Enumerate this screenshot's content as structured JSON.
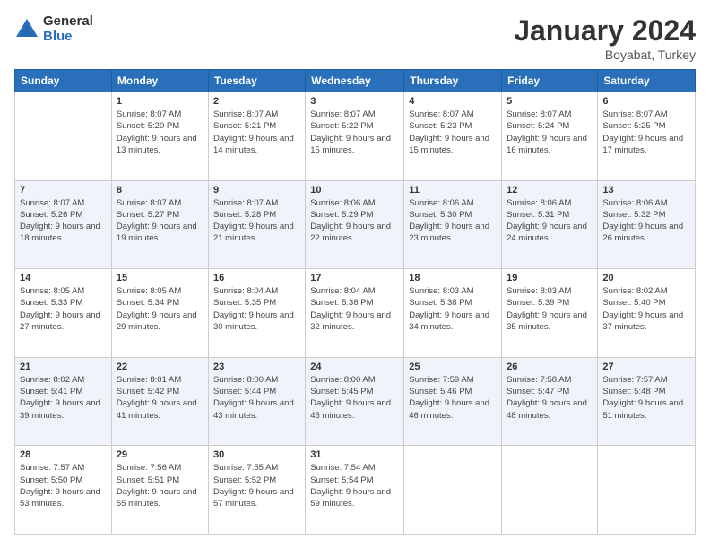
{
  "logo": {
    "general": "General",
    "blue": "Blue"
  },
  "header": {
    "title": "January 2024",
    "subtitle": "Boyabat, Turkey"
  },
  "days_of_week": [
    "Sunday",
    "Monday",
    "Tuesday",
    "Wednesday",
    "Thursday",
    "Friday",
    "Saturday"
  ],
  "weeks": [
    [
      {
        "day": "",
        "sunrise": "",
        "sunset": "",
        "daylight": ""
      },
      {
        "day": "1",
        "sunrise": "Sunrise: 8:07 AM",
        "sunset": "Sunset: 5:20 PM",
        "daylight": "Daylight: 9 hours and 13 minutes."
      },
      {
        "day": "2",
        "sunrise": "Sunrise: 8:07 AM",
        "sunset": "Sunset: 5:21 PM",
        "daylight": "Daylight: 9 hours and 14 minutes."
      },
      {
        "day": "3",
        "sunrise": "Sunrise: 8:07 AM",
        "sunset": "Sunset: 5:22 PM",
        "daylight": "Daylight: 9 hours and 15 minutes."
      },
      {
        "day": "4",
        "sunrise": "Sunrise: 8:07 AM",
        "sunset": "Sunset: 5:23 PM",
        "daylight": "Daylight: 9 hours and 15 minutes."
      },
      {
        "day": "5",
        "sunrise": "Sunrise: 8:07 AM",
        "sunset": "Sunset: 5:24 PM",
        "daylight": "Daylight: 9 hours and 16 minutes."
      },
      {
        "day": "6",
        "sunrise": "Sunrise: 8:07 AM",
        "sunset": "Sunset: 5:25 PM",
        "daylight": "Daylight: 9 hours and 17 minutes."
      }
    ],
    [
      {
        "day": "7",
        "sunrise": "Sunrise: 8:07 AM",
        "sunset": "Sunset: 5:26 PM",
        "daylight": "Daylight: 9 hours and 18 minutes."
      },
      {
        "day": "8",
        "sunrise": "Sunrise: 8:07 AM",
        "sunset": "Sunset: 5:27 PM",
        "daylight": "Daylight: 9 hours and 19 minutes."
      },
      {
        "day": "9",
        "sunrise": "Sunrise: 8:07 AM",
        "sunset": "Sunset: 5:28 PM",
        "daylight": "Daylight: 9 hours and 21 minutes."
      },
      {
        "day": "10",
        "sunrise": "Sunrise: 8:06 AM",
        "sunset": "Sunset: 5:29 PM",
        "daylight": "Daylight: 9 hours and 22 minutes."
      },
      {
        "day": "11",
        "sunrise": "Sunrise: 8:06 AM",
        "sunset": "Sunset: 5:30 PM",
        "daylight": "Daylight: 9 hours and 23 minutes."
      },
      {
        "day": "12",
        "sunrise": "Sunrise: 8:06 AM",
        "sunset": "Sunset: 5:31 PM",
        "daylight": "Daylight: 9 hours and 24 minutes."
      },
      {
        "day": "13",
        "sunrise": "Sunrise: 8:06 AM",
        "sunset": "Sunset: 5:32 PM",
        "daylight": "Daylight: 9 hours and 26 minutes."
      }
    ],
    [
      {
        "day": "14",
        "sunrise": "Sunrise: 8:05 AM",
        "sunset": "Sunset: 5:33 PM",
        "daylight": "Daylight: 9 hours and 27 minutes."
      },
      {
        "day": "15",
        "sunrise": "Sunrise: 8:05 AM",
        "sunset": "Sunset: 5:34 PM",
        "daylight": "Daylight: 9 hours and 29 minutes."
      },
      {
        "day": "16",
        "sunrise": "Sunrise: 8:04 AM",
        "sunset": "Sunset: 5:35 PM",
        "daylight": "Daylight: 9 hours and 30 minutes."
      },
      {
        "day": "17",
        "sunrise": "Sunrise: 8:04 AM",
        "sunset": "Sunset: 5:36 PM",
        "daylight": "Daylight: 9 hours and 32 minutes."
      },
      {
        "day": "18",
        "sunrise": "Sunrise: 8:03 AM",
        "sunset": "Sunset: 5:38 PM",
        "daylight": "Daylight: 9 hours and 34 minutes."
      },
      {
        "day": "19",
        "sunrise": "Sunrise: 8:03 AM",
        "sunset": "Sunset: 5:39 PM",
        "daylight": "Daylight: 9 hours and 35 minutes."
      },
      {
        "day": "20",
        "sunrise": "Sunrise: 8:02 AM",
        "sunset": "Sunset: 5:40 PM",
        "daylight": "Daylight: 9 hours and 37 minutes."
      }
    ],
    [
      {
        "day": "21",
        "sunrise": "Sunrise: 8:02 AM",
        "sunset": "Sunset: 5:41 PM",
        "daylight": "Daylight: 9 hours and 39 minutes."
      },
      {
        "day": "22",
        "sunrise": "Sunrise: 8:01 AM",
        "sunset": "Sunset: 5:42 PM",
        "daylight": "Daylight: 9 hours and 41 minutes."
      },
      {
        "day": "23",
        "sunrise": "Sunrise: 8:00 AM",
        "sunset": "Sunset: 5:44 PM",
        "daylight": "Daylight: 9 hours and 43 minutes."
      },
      {
        "day": "24",
        "sunrise": "Sunrise: 8:00 AM",
        "sunset": "Sunset: 5:45 PM",
        "daylight": "Daylight: 9 hours and 45 minutes."
      },
      {
        "day": "25",
        "sunrise": "Sunrise: 7:59 AM",
        "sunset": "Sunset: 5:46 PM",
        "daylight": "Daylight: 9 hours and 46 minutes."
      },
      {
        "day": "26",
        "sunrise": "Sunrise: 7:58 AM",
        "sunset": "Sunset: 5:47 PM",
        "daylight": "Daylight: 9 hours and 48 minutes."
      },
      {
        "day": "27",
        "sunrise": "Sunrise: 7:57 AM",
        "sunset": "Sunset: 5:48 PM",
        "daylight": "Daylight: 9 hours and 51 minutes."
      }
    ],
    [
      {
        "day": "28",
        "sunrise": "Sunrise: 7:57 AM",
        "sunset": "Sunset: 5:50 PM",
        "daylight": "Daylight: 9 hours and 53 minutes."
      },
      {
        "day": "29",
        "sunrise": "Sunrise: 7:56 AM",
        "sunset": "Sunset: 5:51 PM",
        "daylight": "Daylight: 9 hours and 55 minutes."
      },
      {
        "day": "30",
        "sunrise": "Sunrise: 7:55 AM",
        "sunset": "Sunset: 5:52 PM",
        "daylight": "Daylight: 9 hours and 57 minutes."
      },
      {
        "day": "31",
        "sunrise": "Sunrise: 7:54 AM",
        "sunset": "Sunset: 5:54 PM",
        "daylight": "Daylight: 9 hours and 59 minutes."
      },
      {
        "day": "",
        "sunrise": "",
        "sunset": "",
        "daylight": ""
      },
      {
        "day": "",
        "sunrise": "",
        "sunset": "",
        "daylight": ""
      },
      {
        "day": "",
        "sunrise": "",
        "sunset": "",
        "daylight": ""
      }
    ]
  ]
}
